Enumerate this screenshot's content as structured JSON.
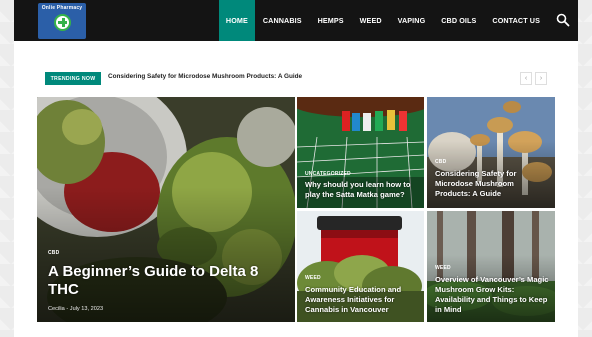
{
  "logo": {
    "text": "Onlie Pharmacy"
  },
  "nav": {
    "items": [
      {
        "label": "HOME",
        "active": true
      },
      {
        "label": "CANNABIS",
        "active": false
      },
      {
        "label": "HEMPS",
        "active": false
      },
      {
        "label": "WEED",
        "active": false
      },
      {
        "label": "VAPING",
        "active": false
      },
      {
        "label": "CBD OILS",
        "active": false
      },
      {
        "label": "CONTACT US",
        "active": false
      }
    ],
    "search_icon": "search-icon"
  },
  "trending": {
    "badge": "TRENDING NOW",
    "title": "Considering Safety for Microdose Mushroom Products: A Guide",
    "prev_icon": "chevron-left-icon",
    "next_icon": "chevron-right-icon"
  },
  "featured": {
    "category": "CBD",
    "title": "A Beginner’s Guide to Delta 8 THC",
    "author": "Cecilia",
    "date": "July 13, 2023"
  },
  "tiles": [
    {
      "category": "UNCATEGORIZED",
      "title": "Why should you learn how to play the Satta Matka game?"
    },
    {
      "category": "CBD",
      "title": "Considering Safety for Microdose Mushroom Products: A Guide"
    },
    {
      "category": "WEED",
      "title": "Community Education and Awareness Initiatives for Cannabis in Vancouver"
    },
    {
      "category": "WEED",
      "title": "Overview of Vancouver’s Magic Mushroom Grow Kits: Availability and Things to Keep in Mind"
    }
  ],
  "colors": {
    "accent": "#00897b",
    "header": "#141414"
  }
}
